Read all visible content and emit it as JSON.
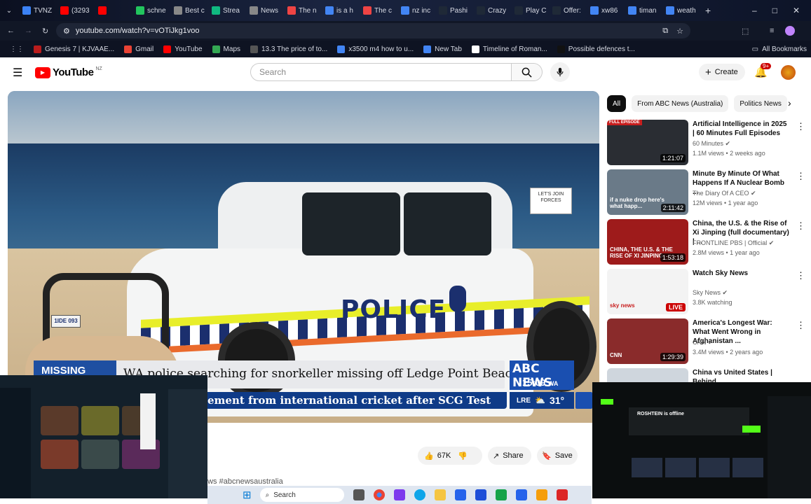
{
  "browser": {
    "tabs": [
      {
        "label": "TVNZ",
        "color": "#3b82f6"
      },
      {
        "label": "(3293",
        "color": "#ff0000"
      },
      {
        "label": "",
        "color": "#ff0000"
      },
      {
        "label": "schne",
        "color": "#22c55e"
      },
      {
        "label": "Best c",
        "color": "#888888"
      },
      {
        "label": "Strea",
        "color": "#10b981"
      },
      {
        "label": "News",
        "color": "#888888"
      },
      {
        "label": "The n",
        "color": "#ef4444"
      },
      {
        "label": "is a h",
        "color": "#4285f4"
      },
      {
        "label": "The c",
        "color": "#ef4444"
      },
      {
        "label": "nz inc",
        "color": "#4285f4"
      },
      {
        "label": "Pashi",
        "color": "#1f2937"
      },
      {
        "label": "Crazy",
        "color": "#1f2937"
      },
      {
        "label": "Play C",
        "color": "#1f2937"
      },
      {
        "label": "Offer:",
        "color": "#1f2937"
      },
      {
        "label": "xw86",
        "color": "#4285f4"
      },
      {
        "label": "timan",
        "color": "#4285f4"
      },
      {
        "label": "weath",
        "color": "#4285f4"
      }
    ],
    "url": "youtube.com/watch?v=vOTiJkg1voo",
    "bookmarks": [
      {
        "label": "Genesis 7 | KJVAAE...",
        "color": "#b91c1c"
      },
      {
        "label": "Gmail",
        "color": "#ea4335"
      },
      {
        "label": "YouTube",
        "color": "#ff0000"
      },
      {
        "label": "Maps",
        "color": "#34a853"
      },
      {
        "label": "13.3 The price of to...",
        "color": "#555555"
      },
      {
        "label": "x3500 m4 how to u...",
        "color": "#4285f4"
      },
      {
        "label": "New Tab",
        "color": "#4285f4"
      },
      {
        "label": "Timeline of Roman...",
        "color": "#ffffff"
      },
      {
        "label": "Possible defences t...",
        "color": "#111111"
      }
    ],
    "all_bookmarks": "All Bookmarks"
  },
  "youtube": {
    "logo_text": "YouTube",
    "region": "NZ",
    "search_placeholder": "Search",
    "create_label": "Create",
    "notification_count": "9+"
  },
  "video": {
    "missing_label": "MISSING",
    "headline": "WA police searching for snorkeller missing off Ledge Point Beach",
    "ticker": "ement from international cricket after SCG Test",
    "vehicle_text": "POLICE",
    "sign_text": "LET'S JOIN FORCES",
    "plate": "1IDE 093",
    "abc_title": "ABC NEWS",
    "abc_time": "15:09",
    "abc_tz": "WA",
    "abc_location": "LRE",
    "abc_temp": "31°",
    "hashtag": "ews #abcnewsaustralia"
  },
  "actions": {
    "likes": "67K",
    "share": "Share",
    "save": "Save"
  },
  "chips": [
    "All",
    "From ABC News (Australia)",
    "Politics News"
  ],
  "recommendations": [
    {
      "title": "Artificial Intelligence in 2025 | 60 Minutes Full Episodes",
      "channel": "60 Minutes",
      "meta": "1.1M views • 2 weeks ago",
      "duration": "1:21:07",
      "badge": "FULL EPISODE",
      "thumb": "#2a2d33"
    },
    {
      "title": "Minute By Minute Of What Happens If A Nuclear Bomb ...",
      "channel": "The Diary Of A CEO",
      "meta": "12M views • 1 year ago",
      "duration": "2:11:42",
      "caption": "if a nuke drop here's what happ...",
      "thumb": "#6a7a88"
    },
    {
      "title": "China, the U.S. & the Rise of Xi Jinping (full documentary) | ...",
      "channel": "FRONTLINE PBS | Official",
      "meta": "2.8M views • 1 year ago",
      "duration": "1:53:18",
      "caption": "CHINA, THE U.S. & THE RISE OF XI JINPING",
      "thumb": "#9e1b1b"
    },
    {
      "title": "Watch Sky News",
      "channel": "Sky News",
      "meta": "3.8K watching",
      "live": "LIVE",
      "caption": "sky news",
      "thumb": "#f3f3f3"
    },
    {
      "title": "America's Longest War: What Went Wrong in Afghanistan ...",
      "channel": "CNN",
      "meta": "3.4M views • 2 years ago",
      "duration": "1:29:39",
      "caption": "CNN",
      "thumb": "#8a2b2b"
    },
    {
      "title": "China vs United States | Behind",
      "channel": "",
      "meta": "",
      "thumb": "#cfd6dd"
    }
  ],
  "pip_right": {
    "status": "ROSHTEIN is offline"
  },
  "taskbar": {
    "search": "Search"
  }
}
